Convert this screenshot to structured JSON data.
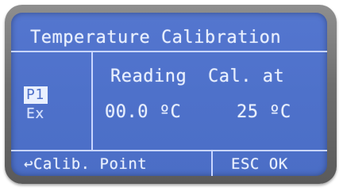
{
  "screen": {
    "title": "Temperature Calibration",
    "options": {
      "selected": "P1",
      "other": "Ex"
    },
    "columns": {
      "reading_label": "Reading",
      "cal_label": "Cal. at"
    },
    "values": {
      "reading_value": "00.0 ºC",
      "cal_value": "25 ºC"
    },
    "footer": {
      "left": "↩Calib. Point",
      "right": "ESC OK"
    }
  },
  "colors": {
    "lcd_background": "#4e71ca",
    "lcd_text": "#e9f0ff",
    "bezel": "#6e6e6e"
  }
}
